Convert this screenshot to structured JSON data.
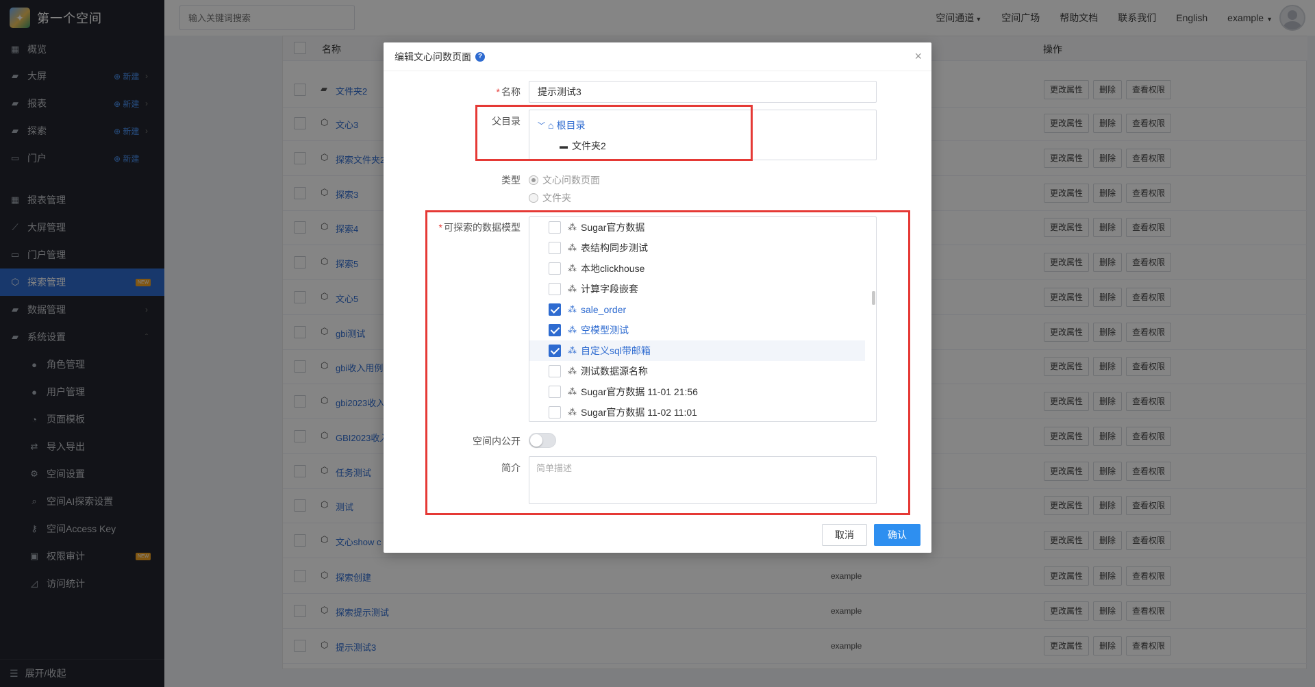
{
  "sidebar": {
    "space_name": "第一个空间",
    "new_label": "新建",
    "items": [
      {
        "label": "概览",
        "icon": "dashboard-icon"
      },
      {
        "label": "大屏",
        "icon": "folder-icon"
      },
      {
        "label": "报表",
        "icon": "folder-icon"
      },
      {
        "label": "探索",
        "icon": "folder-icon"
      },
      {
        "label": "门户",
        "icon": "window-icon"
      },
      {
        "label": "报表管理",
        "icon": "grid-icon"
      },
      {
        "label": "大屏管理",
        "icon": "line-chart-icon"
      },
      {
        "label": "门户管理",
        "icon": "window-icon"
      },
      {
        "label": "探索管理",
        "icon": "explore-icon",
        "badge": "NEW"
      },
      {
        "label": "数据管理",
        "icon": "folder-icon"
      },
      {
        "label": "系统设置",
        "icon": "folder-icon"
      },
      {
        "label": "角色管理",
        "icon": "users-icon"
      },
      {
        "label": "用户管理",
        "icon": "user-icon"
      },
      {
        "label": "页面模板",
        "icon": "dashboard-gauge-icon"
      },
      {
        "label": "导入导出",
        "icon": "exchange-icon"
      },
      {
        "label": "空间设置",
        "icon": "gear-icon"
      },
      {
        "label": "空间AI探索设置",
        "icon": "search-icon"
      },
      {
        "label": "空间Access Key",
        "icon": "key-icon"
      },
      {
        "label": "权限审计",
        "icon": "id-card-icon",
        "badge": "NEW"
      },
      {
        "label": "访问统计",
        "icon": "area-chart-icon"
      }
    ],
    "collapse_label": "展开/收起"
  },
  "topbar": {
    "search_placeholder": "输入关键词搜索",
    "links": [
      "空间通道",
      "空间广场",
      "帮助文档",
      "联系我们",
      "English",
      "example"
    ]
  },
  "table": {
    "col_name": "名称",
    "col_actions": "操作",
    "actions": [
      "更改属性",
      "删除",
      "查看权限"
    ],
    "rows": [
      {
        "name": "文件夹2",
        "type": "folder",
        "owner": ""
      },
      {
        "name": "文心3",
        "type": "explore",
        "owner": ""
      },
      {
        "name": "探索文件夹2",
        "type": "explore",
        "owner": ""
      },
      {
        "name": "探索3",
        "type": "explore",
        "owner": ""
      },
      {
        "name": "探索4",
        "type": "explore",
        "owner": ""
      },
      {
        "name": "探索5",
        "type": "explore",
        "owner": ""
      },
      {
        "name": "文心5",
        "type": "explore",
        "owner": ""
      },
      {
        "name": "gbi测试",
        "type": "explore",
        "owner": ""
      },
      {
        "name": "gbi收入用例",
        "type": "explore",
        "owner": ""
      },
      {
        "name": "gbi2023收入",
        "type": "explore",
        "owner": ""
      },
      {
        "name": "GBI2023收入",
        "type": "explore",
        "owner": ""
      },
      {
        "name": "任务测试",
        "type": "explore",
        "owner": ""
      },
      {
        "name": "测试",
        "type": "explore",
        "owner": ""
      },
      {
        "name": "文心show c",
        "type": "explore",
        "owner": ""
      },
      {
        "name": "探索创建",
        "type": "explore",
        "owner": "example"
      },
      {
        "name": "探索提示测试",
        "type": "explore",
        "owner": "example"
      },
      {
        "name": "提示测试3",
        "type": "explore",
        "owner": "example"
      }
    ]
  },
  "modal": {
    "title": "编辑文心问数页面",
    "name_label": "名称",
    "name_value": "提示测试3",
    "parent_label": "父目录",
    "tree_root": "根目录",
    "tree_child": "文件夹2",
    "type_label": "类型",
    "type_options": [
      "文心问数页面",
      "文件夹"
    ],
    "models_label": "可探索的数据模型",
    "models": [
      {
        "label": "Sugar官方数据",
        "checked": false
      },
      {
        "label": "表结构同步测试",
        "checked": false
      },
      {
        "label": "本地clickhouse",
        "checked": false
      },
      {
        "label": "计算字段嵌套",
        "checked": false
      },
      {
        "label": "sale_order",
        "checked": true
      },
      {
        "label": "空模型测试",
        "checked": true
      },
      {
        "label": "自定义sql带邮箱",
        "checked": true
      },
      {
        "label": "测试数据源名称",
        "checked": false
      },
      {
        "label": "Sugar官方数据 11-01 21:56",
        "checked": false
      },
      {
        "label": "Sugar官方数据 11-02 11:01",
        "checked": false
      }
    ],
    "public_label": "空间内公开",
    "desc_label": "简介",
    "desc_placeholder": "简单描述",
    "cancel": "取消",
    "confirm": "确认"
  },
  "colors": {
    "primary": "#2e6bd0",
    "confirm": "#2e8ff0",
    "sidebar_bg": "#23262e",
    "highlight_red": "#e53935",
    "badge": "#f6a623"
  }
}
